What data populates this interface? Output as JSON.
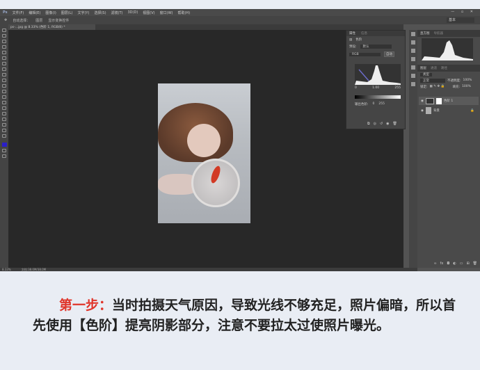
{
  "app": {
    "logo": "Ps",
    "menu": [
      "文件(F)",
      "编辑(E)",
      "图像(I)",
      "图层(L)",
      "文字(Y)",
      "选择(S)",
      "滤镜(T)",
      "3D(D)",
      "视图(V)",
      "窗口(W)",
      "帮助(H)"
    ],
    "window_controls": "— ▫ ✕"
  },
  "options": {
    "auto_select": "自动选择：",
    "layer": "图层",
    "show_transform": "显示变换控件",
    "workspace": "基本"
  },
  "document_tab": "ps-...jpg @ 8.33% (色阶 1, RGB/8) *",
  "status": {
    "zoom": "8.33%",
    "doc": "文档:38.0M/38.0M"
  },
  "properties": {
    "tabs": [
      "属性",
      "信息"
    ],
    "title": "色阶",
    "preset_label": "预设:",
    "preset": "默认",
    "channel": "RGB",
    "auto": "自动",
    "input": [
      "0",
      "1.00",
      "255"
    ],
    "output_label": "输出色阶:",
    "output": [
      "0",
      "255"
    ]
  },
  "histogram_panel": {
    "tabs": [
      "直方图",
      "导航器"
    ]
  },
  "layers": {
    "tabs": [
      "图层",
      "通道",
      "路径"
    ],
    "filter": "类型",
    "blend": "正常",
    "opacity_label": "不透明度:",
    "opacity": "100%",
    "lock_label": "锁定:",
    "fill_label": "填充:",
    "fill": "100%",
    "items": [
      {
        "name": "色阶 1"
      },
      {
        "name": "背景"
      }
    ]
  },
  "caption": {
    "step": "第一步：",
    "text": "当时拍摄天气原因，导致光线不够充足，照片偏暗，所以首先使用【色阶】提亮阴影部分，注意不要拉太过使照片曝光。"
  }
}
